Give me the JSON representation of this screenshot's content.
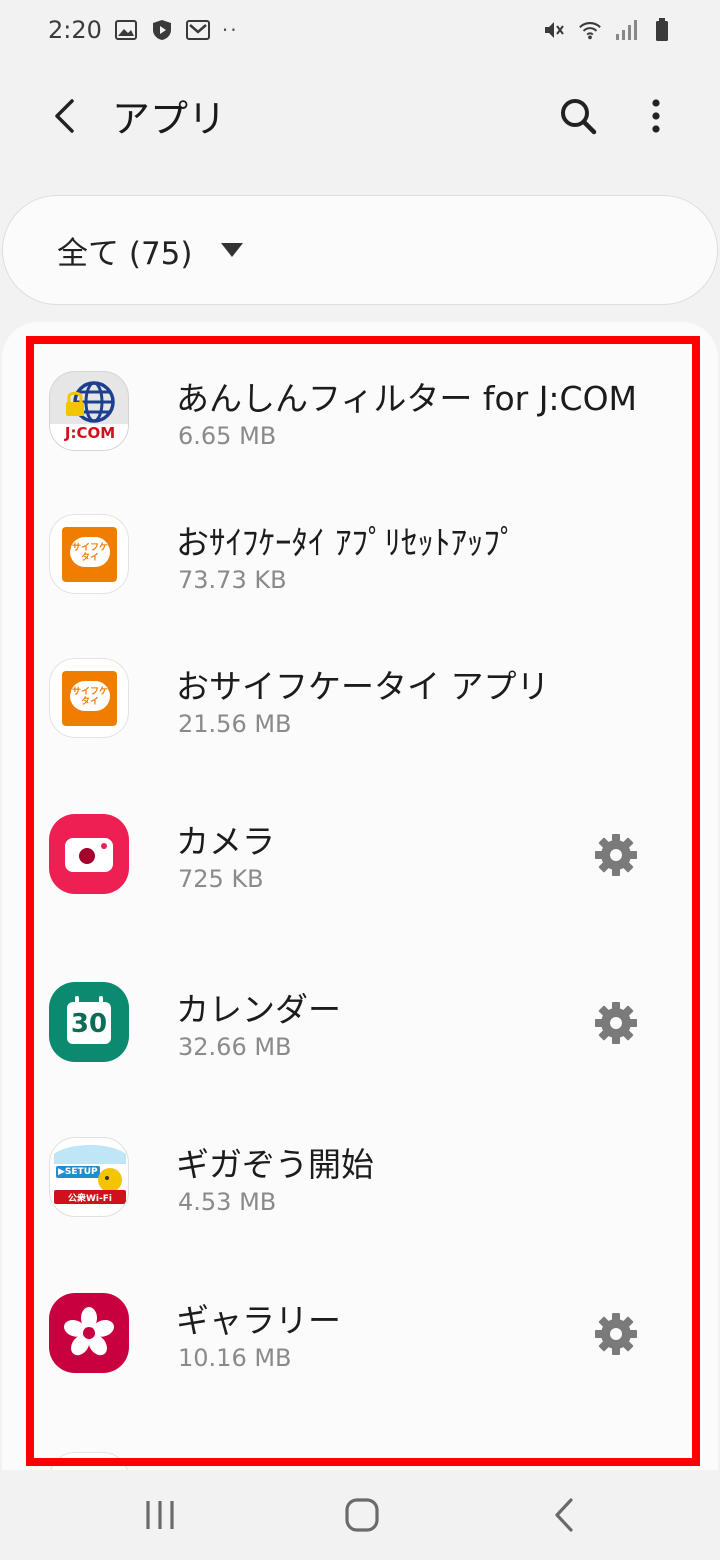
{
  "status_bar": {
    "time": "2:20",
    "more": "··",
    "left_icons": [
      "image-icon",
      "shield-icon",
      "mail-icon"
    ],
    "right_icons": [
      "mute-icon",
      "wifi-icon",
      "signal-icon",
      "battery-icon"
    ]
  },
  "app_bar": {
    "title": "アプリ",
    "icons": [
      "back-icon",
      "search-icon",
      "more-vert-icon"
    ]
  },
  "filter": {
    "label": "全て (75)"
  },
  "apps": [
    {
      "name": "あんしんフィルター for J:COM",
      "size": "6.65 MB",
      "icon": "anshin-filter-icon",
      "icon_text": "J:COM",
      "has_settings": false
    },
    {
      "name": "おｻｲﾌｹｰﾀｲ ｱﾌﾟﾘｾｯﾄｱｯﾌﾟ",
      "size": "73.73 KB",
      "icon": "osaifu-setup-icon",
      "icon_text": "おサイフケータイ",
      "has_settings": false
    },
    {
      "name": "おサイフケータイ アプリ",
      "size": "21.56 MB",
      "icon": "osaifu-icon",
      "icon_text": "おサイフケータイ",
      "has_settings": false
    },
    {
      "name": "カメラ",
      "size": "725 KB",
      "icon": "camera-icon",
      "has_settings": true
    },
    {
      "name": "カレンダー",
      "size": "32.66 MB",
      "icon": "calendar-icon",
      "icon_text": "30",
      "has_settings": true
    },
    {
      "name": "ギガぞう開始",
      "size": "4.53 MB",
      "icon": "gigazo-icon",
      "icon_text": "▶SETUP",
      "icon_text2": "公衆Wi-Fi",
      "has_settings": false
    },
    {
      "name": "ギャラリー",
      "size": "10.16 MB",
      "icon": "gallery-icon",
      "has_settings": true
    }
  ],
  "colors": {
    "highlight": "#ff0000",
    "camera": "#ee1f52",
    "calendar": "#0c8a6f",
    "gallery": "#c8003f",
    "osaifu": "#ee7d00"
  },
  "nav_bar": {
    "icons": [
      "recents-icon",
      "home-icon",
      "back-nav-icon"
    ]
  }
}
